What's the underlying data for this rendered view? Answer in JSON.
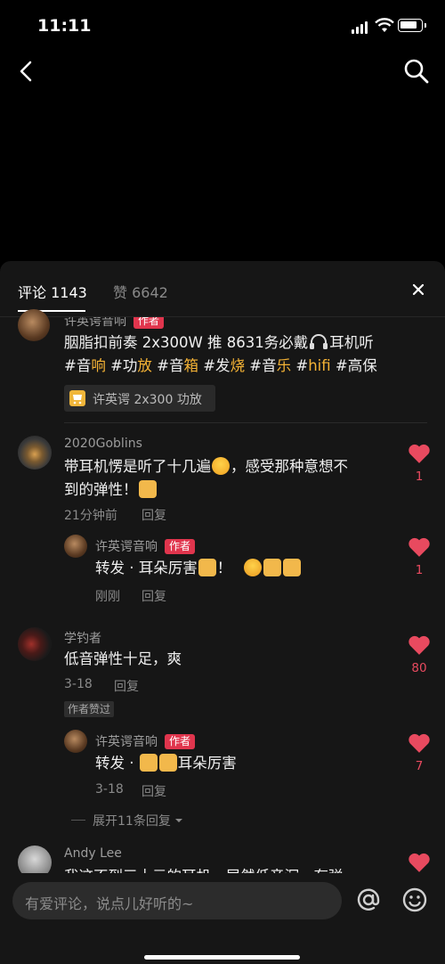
{
  "status": {
    "time": "11:11"
  },
  "tabs": {
    "comments": "评论 1143",
    "likes": "赞 6642"
  },
  "comments": [
    {
      "name": "许英谔音响",
      "tag": "作者",
      "line1": "胭脂扣前奏 2x300W 推 8631务必戴",
      "line1_tail": "耳机听",
      "line2": [
        {
          "t": "#音",
          "c": "hash"
        },
        {
          "t": "响",
          "c": "hl"
        },
        {
          "t": " #功",
          "c": "hash"
        },
        {
          "t": "放",
          "c": "hl"
        },
        {
          "t": " #音",
          "c": "hash"
        },
        {
          "t": "箱",
          "c": "hl"
        },
        {
          "t": " #发",
          "c": "hash"
        },
        {
          "t": "烧",
          "c": "hl"
        },
        {
          "t": " #音",
          "c": "hash"
        },
        {
          "t": "乐",
          "c": "hl"
        },
        {
          "t": " #",
          "c": "hash"
        },
        {
          "t": "hifi",
          "c": "hl"
        },
        {
          "t": " #高保",
          "c": "hash"
        }
      ],
      "product": "许英谔 2x300 功放"
    },
    {
      "name": "2020Goblins",
      "line1": "带耳机愣是听了十几遍",
      "line1_tail": "，感受那种意想不",
      "line2": "到的弹性！",
      "time": "21分钟前",
      "reply": "回复",
      "likes": "1"
    },
    {
      "name": "许英谔音响",
      "tag": "作者",
      "line1": "转发 · 耳朵厉害",
      "line1_tail": "！",
      "time": "刚刚",
      "reply": "回复",
      "likes": "1"
    },
    {
      "name": "学钓者",
      "line1": "低音弹性十足，爽",
      "time": "3-18",
      "reply": "回复",
      "badge": "作者赞过",
      "likes": "80"
    },
    {
      "name": "许英谔音响",
      "tag": "作者",
      "line1": "转发 · ",
      "line1_tail": "耳朵厉害",
      "time": "3-18",
      "reply": "回复",
      "likes": "7"
    },
    {
      "name": "Andy Lee",
      "line1": "我这不到三十元的耳机，居然低音沉，有弹"
    }
  ],
  "expand": "展开11条回复",
  "input": {
    "placeholder": "有爱评论，说点儿好听的~"
  },
  "colors": {
    "like": "#e84a5f",
    "author_tag": "#e0354d",
    "hashtag_hl": "#f5b335"
  }
}
